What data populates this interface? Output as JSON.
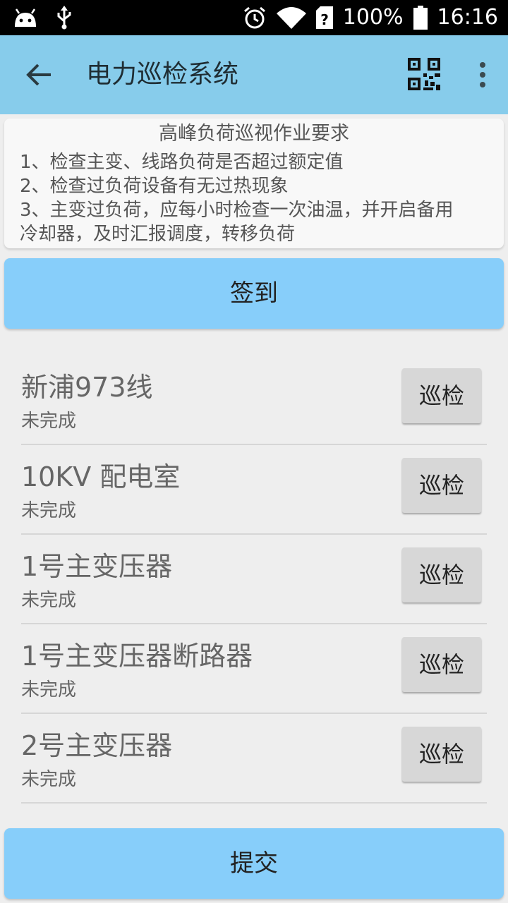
{
  "status_bar": {
    "battery": "100%",
    "time": "16:16",
    "icons": [
      "android-icon",
      "usb-icon",
      "alarm-icon",
      "wifi-icon",
      "sim-unknown-icon",
      "battery-icon"
    ]
  },
  "app_bar": {
    "title": "电力巡检系统",
    "icons": [
      "back-arrow-icon",
      "qr-code-icon",
      "overflow-menu-icon"
    ],
    "color": "#87cceb"
  },
  "requirements": {
    "title": "高峰负荷巡视作业要求",
    "lines": [
      "1、检查主变、线路负荷是否超过额定值",
      "2、检查过负荷设备有无过热现象",
      "3、主变过负荷，应每小时检查一次油温，并开启备用",
      "冷却器，及时汇报调度，转移负荷"
    ]
  },
  "checkin_label": "签到",
  "items": [
    {
      "name": "新浦973线",
      "status": "未完成",
      "action": "巡检"
    },
    {
      "name": "10KV 配电室",
      "status": "未完成",
      "action": "巡检"
    },
    {
      "name": "1号主变压器",
      "status": "未完成",
      "action": "巡检"
    },
    {
      "name": "1号主变压器断路器",
      "status": "未完成",
      "action": "巡检"
    },
    {
      "name": "2号主变压器",
      "status": "未完成",
      "action": "巡检"
    }
  ],
  "submit_label": "提交",
  "colors": {
    "accent_button": "#87cefa",
    "background": "#eeeeee"
  }
}
